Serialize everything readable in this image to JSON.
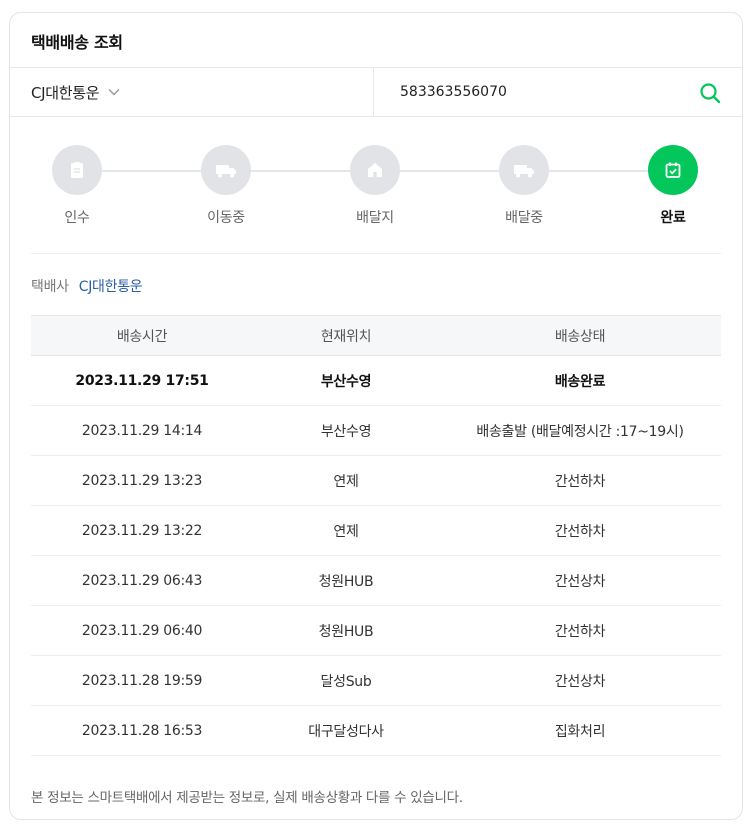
{
  "header": {
    "title": "택배배송 조회"
  },
  "search": {
    "carrier": "CJ대한통운",
    "tracking_number": "583363556070"
  },
  "steps": [
    {
      "label": "인수",
      "icon": "clipboard-icon",
      "state": "inactive"
    },
    {
      "label": "이동중",
      "icon": "truck-icon",
      "state": "inactive"
    },
    {
      "label": "배달지",
      "icon": "house-icon",
      "state": "inactive"
    },
    {
      "label": "배달중",
      "icon": "delivery-truck-icon",
      "state": "inactive"
    },
    {
      "label": "완료",
      "icon": "calendar-check-icon",
      "state": "active"
    }
  ],
  "company": {
    "label": "택배사",
    "name": "CJ대한통운"
  },
  "table": {
    "headers": [
      "배송시간",
      "현재위치",
      "배송상태"
    ],
    "rows": [
      {
        "time": "2023.11.29 17:51",
        "location": "부산수영",
        "status": "배송완료"
      },
      {
        "time": "2023.11.29 14:14",
        "location": "부산수영",
        "status": "배송출발 (배달예정시간 :17~19시)"
      },
      {
        "time": "2023.11.29 13:23",
        "location": "연제",
        "status": "간선하차"
      },
      {
        "time": "2023.11.29 13:22",
        "location": "연제",
        "status": "간선하차"
      },
      {
        "time": "2023.11.29 06:43",
        "location": "청원HUB",
        "status": "간선상차"
      },
      {
        "time": "2023.11.29 06:40",
        "location": "청원HUB",
        "status": "간선하차"
      },
      {
        "time": "2023.11.28 19:59",
        "location": "달성Sub",
        "status": "간선상차"
      },
      {
        "time": "2023.11.28 16:53",
        "location": "대구달성다사",
        "status": "집화처리"
      }
    ]
  },
  "footer": {
    "note": "본 정보는 스마트택배에서 제공받는 정보로, 실제 배송상황과 다를 수 있습니다."
  },
  "colors": {
    "accent": "#03c75a",
    "link": "#2a5ea8",
    "inactive_step": "#e1e3e6"
  }
}
